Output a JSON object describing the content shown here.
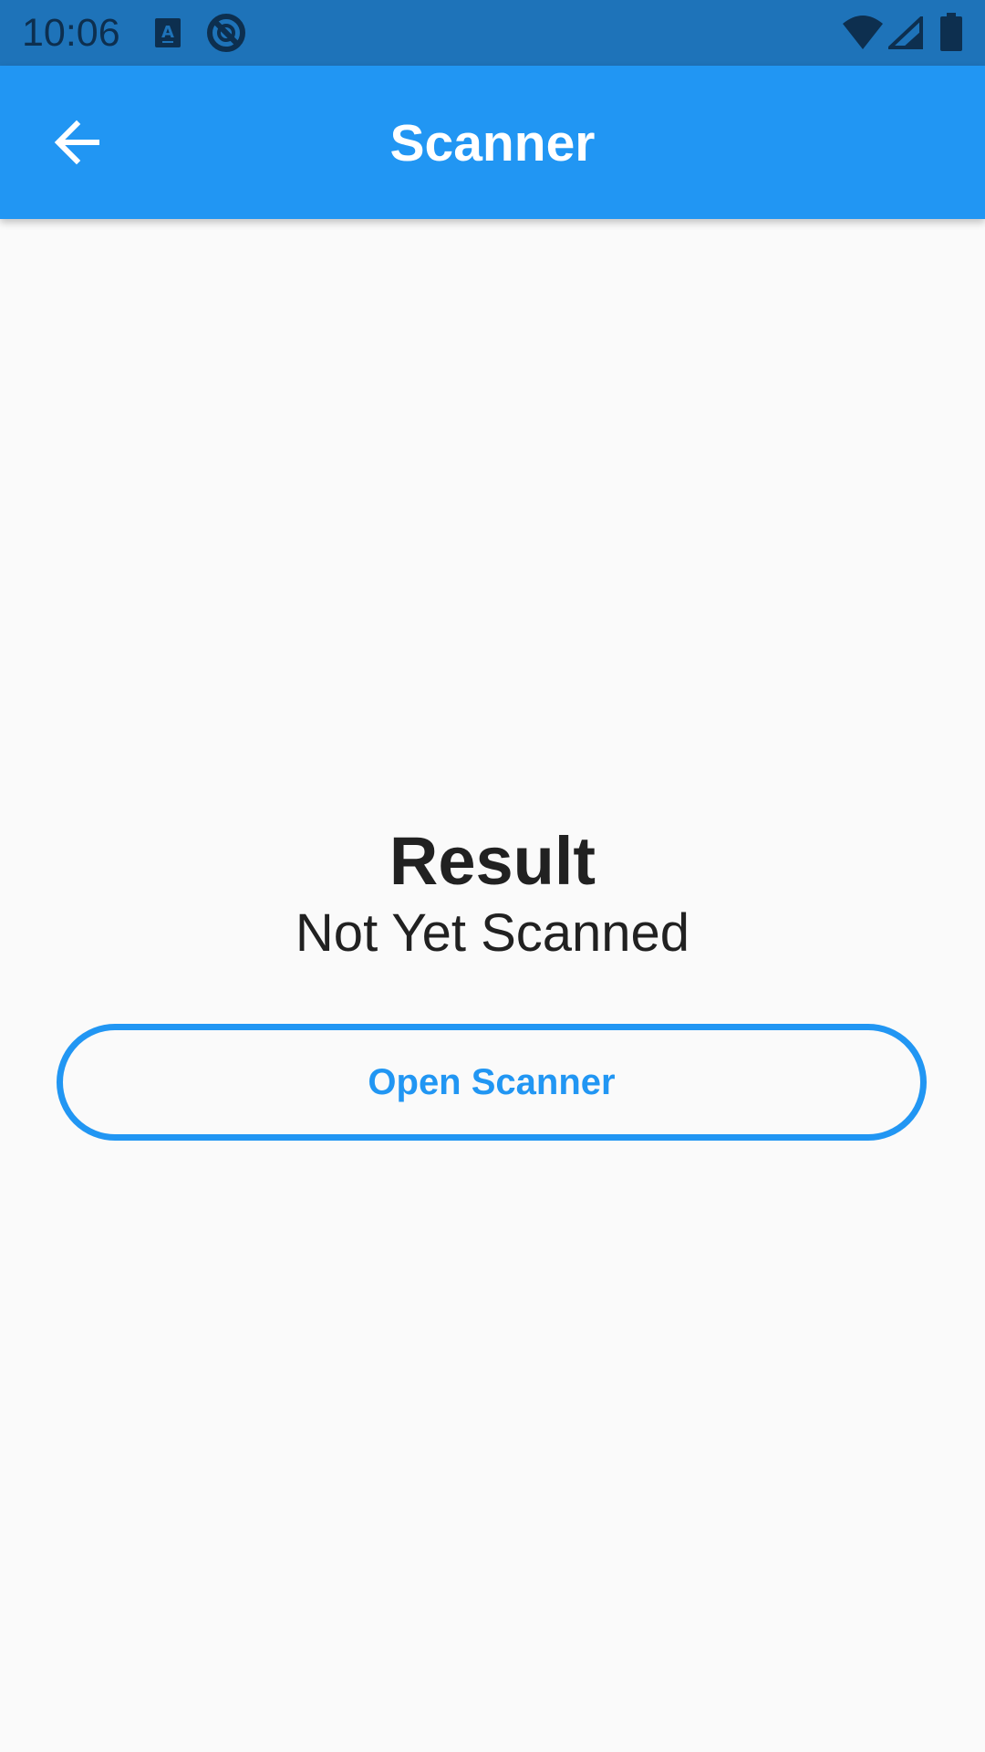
{
  "status_bar": {
    "time": "10:06",
    "icons": [
      "keyboard-a-icon",
      "do-not-disturb-icon",
      "wifi-icon",
      "cell-signal-icon",
      "battery-icon"
    ]
  },
  "app_bar": {
    "title": "Scanner",
    "back_icon": "arrow-back-icon"
  },
  "main": {
    "result_label": "Result",
    "result_value": "Not Yet Scanned",
    "open_button_label": "Open Scanner"
  },
  "colors": {
    "status_bar": "#1e73b9",
    "app_bar": "#2196f3",
    "accent": "#2196f3",
    "background": "#fafafa",
    "text": "#212121"
  }
}
